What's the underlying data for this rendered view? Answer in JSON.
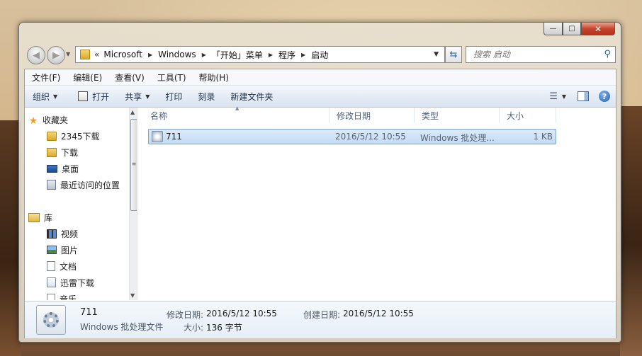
{
  "window": {
    "caption_buttons": {
      "minimize": "—",
      "maximize": "□",
      "close": "✕"
    }
  },
  "nav": {
    "back_glyph": "◀",
    "forward_glyph": "▶",
    "address_prefix": "«",
    "breadcrumbs": [
      "Microsoft",
      "Windows",
      "「开始」菜单",
      "程序",
      "启动"
    ],
    "search_placeholder": "搜索 启动"
  },
  "menubar": {
    "items": [
      "文件(F)",
      "编辑(E)",
      "查看(V)",
      "工具(T)",
      "帮助(H)"
    ]
  },
  "toolbar": {
    "organize": "组织",
    "open": "打开",
    "share": "共享",
    "print": "打印",
    "burn": "刻录",
    "new_folder": "新建文件夹"
  },
  "sidebar": {
    "favorites_label": "收藏夹",
    "favorites": [
      "2345下载",
      "下载",
      "桌面",
      "最近访问的位置"
    ],
    "libraries_label": "库",
    "libraries": [
      "视频",
      "图片",
      "文档",
      "迅雷下载",
      "音乐"
    ]
  },
  "columns": {
    "name": "名称",
    "date": "修改日期",
    "type": "类型",
    "size": "大小"
  },
  "files": [
    {
      "name": "711",
      "date": "2016/5/12 10:55",
      "type": "Windows 批处理...",
      "size": "1 KB"
    }
  ],
  "details": {
    "name": "711",
    "type": "Windows 批处理文件",
    "modified_label": "修改日期:",
    "modified_value": "2016/5/12 10:55",
    "created_label": "创建日期:",
    "created_value": "2016/5/12 10:55",
    "size_label": "大小:",
    "size_value": "136 字节"
  },
  "colors": {
    "selection_border": "#7da2ce",
    "toolbar_text": "#1e2d44",
    "header_text": "#4c607a"
  }
}
